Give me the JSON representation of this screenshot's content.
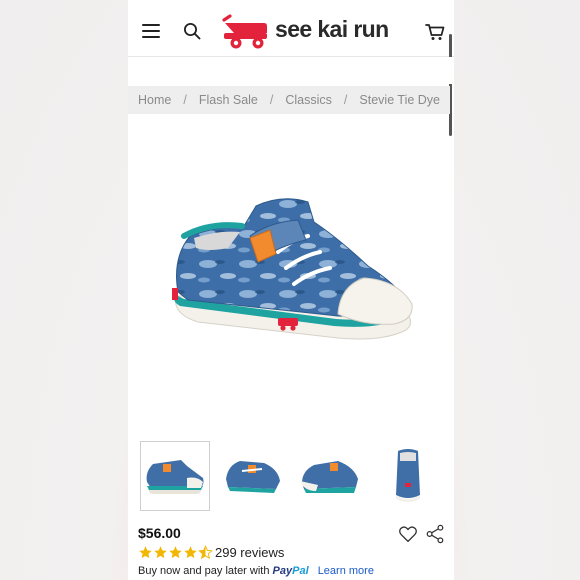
{
  "header": {
    "brand": "see kai run",
    "menu_icon": "hamburger-menu-icon",
    "search_icon": "search-icon",
    "logo_icon": "red-wagon-logo-icon",
    "cart_icon": "shopping-cart-icon"
  },
  "breadcrumb": {
    "items": [
      "Home",
      "Flash Sale",
      "Classics",
      "Stevie Tie Dye"
    ],
    "separator": "/"
  },
  "product": {
    "price": "$56.00",
    "rating": 4.5,
    "reviews": "299 reviews",
    "pay_later_text": "Buy now and pay later with",
    "paypal_part1": "Pay",
    "paypal_part2": "Pal",
    "learn_more": "Learn more"
  },
  "gallery": {
    "thumbnail_count": 4,
    "selected_index": 0
  },
  "colors": {
    "brand_red": "#e2233b",
    "star_gold": "#f2b705",
    "shoe_denim": "#3f6fa6",
    "shoe_teal": "#1fa3a0",
    "tab_orange": "#f28a2e",
    "breadcrumb_bg": "#eeeeee",
    "link_blue": "#1a5bc9"
  }
}
